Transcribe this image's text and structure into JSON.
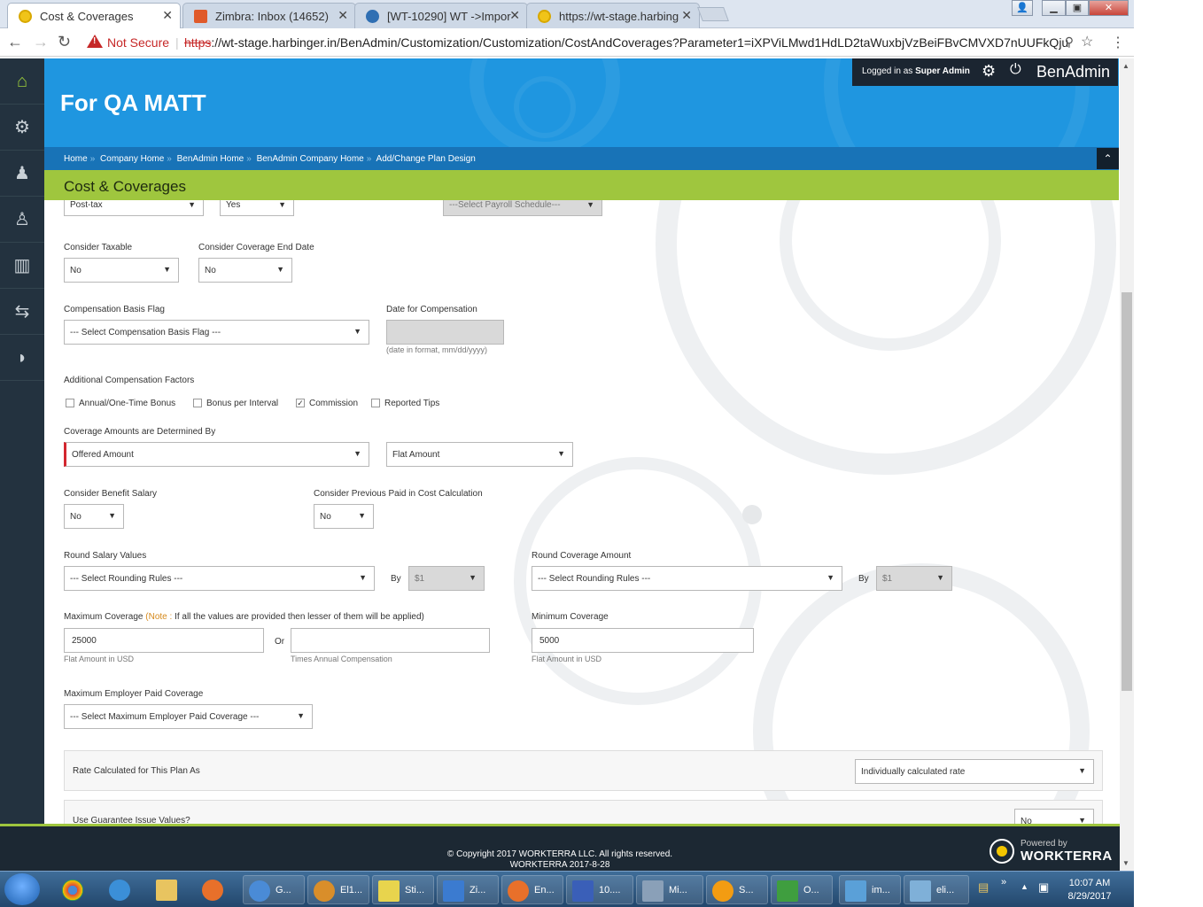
{
  "browser": {
    "tabs": [
      {
        "label": "Cost & Coverages",
        "active": true,
        "favicon_color": "#f0c419"
      },
      {
        "label": "Zimbra: Inbox (14652)",
        "active": false,
        "favicon_color": "#e05a2a"
      },
      {
        "label": "[WT-10290] WT ->Impor",
        "active": false,
        "favicon_color": "#2f6fb3"
      },
      {
        "label": "https://wt-stage.harbing",
        "active": false,
        "favicon_color": "#f0c419"
      }
    ],
    "not_secure": "Not Secure",
    "url_scheme": "https",
    "url_rest": "://wt-stage.harbinger.in/BenAdmin/Customization/Customization/CostAndCoverages?Parameter1=iXPViLMwd1HdLD2taWuxbjVzBeiFBvCMVXD7nUUFkQju"
  },
  "header": {
    "company": "For QA MATT",
    "logged_in_prefix": "Logged in as",
    "logged_in_user": "Super Admin",
    "brand": "BenAdmin"
  },
  "breadcrumb": [
    "Home",
    "Company Home",
    "BenAdmin Home",
    "BenAdmin Company Home",
    "Add/Change Plan Design"
  ],
  "section_title": "Cost & Coverages",
  "form": {
    "top_row": {
      "tax_value": "Post-tax",
      "yes_value": "Yes",
      "payroll_placeholder": "---Select Payroll Schedule---"
    },
    "consider_taxable": {
      "label": "Consider Taxable",
      "value": "No"
    },
    "consider_coverage_end_date": {
      "label": "Consider Coverage End Date",
      "value": "No"
    },
    "compensation_basis_flag": {
      "label": "Compensation Basis Flag",
      "value": "--- Select Compensation Basis Flag ---"
    },
    "date_for_compensation": {
      "label": "Date for Compensation",
      "value": "",
      "hint": "(date in format, mm/dd/yyyy)"
    },
    "additional_compensation_factors": {
      "label": "Additional Compensation Factors",
      "options": [
        {
          "label": "Annual/One-Time Bonus",
          "checked": false
        },
        {
          "label": "Bonus per Interval",
          "checked": false
        },
        {
          "label": "Commission",
          "checked": true
        },
        {
          "label": "Reported Tips",
          "checked": false
        }
      ]
    },
    "coverage_amounts": {
      "label": "Coverage Amounts are Determined By",
      "value": "Offered Amount",
      "type_value": "Flat Amount"
    },
    "consider_benefit_salary": {
      "label": "Consider Benefit Salary",
      "value": "No"
    },
    "consider_previous_paid": {
      "label": "Consider Previous Paid in Cost Calculation",
      "value": "No"
    },
    "round_salary": {
      "label": "Round Salary Values",
      "value": "--- Select Rounding Rules ---",
      "by_label": "By",
      "by_value": "$1"
    },
    "round_coverage": {
      "label": "Round Coverage Amount",
      "value": "--- Select Rounding Rules ---",
      "by_label": "By",
      "by_value": "$1"
    },
    "maximum_coverage": {
      "label": "Maximum Coverage",
      "note_prefix": "(Note :",
      "note_text": " If all the values are provided then lesser of them will be applied)",
      "flat_value": "25000",
      "flat_hint": "Flat Amount in USD",
      "or_label": "Or",
      "times_value": "",
      "times_hint": "Times Annual Compensation"
    },
    "minimum_coverage": {
      "label": "Minimum Coverage",
      "value": "5000",
      "hint": "Flat Amount in USD"
    },
    "maximum_employer_paid": {
      "label": "Maximum Employer Paid Coverage",
      "value": "--- Select Maximum Employer Paid Coverage ---"
    },
    "rate_calculated": {
      "label": "Rate Calculated for This Plan As",
      "value": "Individually calculated rate"
    },
    "guarantee_issue": {
      "label": "Use Guarantee Issue Values?",
      "value": "No"
    }
  },
  "footer": {
    "copyright": "© Copyright 2017 WORKTERRA LLC. All rights reserved.",
    "build": "WORKTERRA 2017-8-28",
    "powered_by": "Powered by",
    "workterra": "WORKTERRA"
  },
  "taskbar": {
    "items": [
      {
        "label": "G...",
        "color": "#4a8bd6"
      },
      {
        "label": "El1...",
        "color": "#d98e2a"
      },
      {
        "label": "Sti...",
        "color": "#e8d44d"
      },
      {
        "label": "Zi...",
        "color": "#3b7bd0"
      },
      {
        "label": "En...",
        "color": "#e8702a"
      },
      {
        "label": "10....",
        "color": "#3a5fb8"
      },
      {
        "label": "Mi...",
        "color": "#8aa0b8"
      },
      {
        "label": "S...",
        "color": "#f39c12"
      },
      {
        "label": "O...",
        "color": "#3f9e3f"
      },
      {
        "label": "im...",
        "color": "#5aa0d8"
      },
      {
        "label": "eli...",
        "color": "#7fb0d8"
      }
    ],
    "time": "10:07 AM",
    "date": "8/29/2017"
  }
}
